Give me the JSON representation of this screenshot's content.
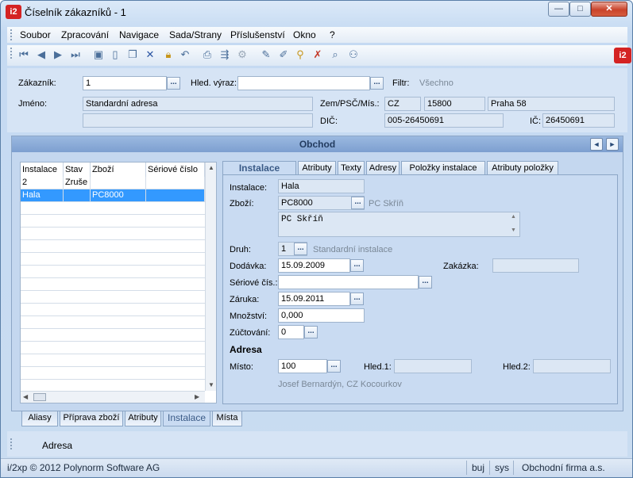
{
  "window": {
    "title": "Číselník zákazníků - 1",
    "app_icon": "i2",
    "controls": {
      "minimize": "—",
      "maximize": "□",
      "close": "✕"
    }
  },
  "menu": [
    "Soubor",
    "Zpracování",
    "Navigace",
    "Sada/Strany",
    "Příslušenství",
    "Okno",
    "?"
  ],
  "toolbar": {
    "icons": [
      "first-icon",
      "prev-icon",
      "next-icon",
      "last-icon",
      "save-icon",
      "new-icon",
      "copy-icon",
      "delete-icon",
      "lock-icon",
      "undo-icon",
      "print-icon",
      "export-icon",
      "settings-icon",
      "pencil-icon",
      "eraser-icon",
      "filter-icon",
      "clear-filter-icon",
      "search-icon",
      "find-user-icon"
    ],
    "logo": "i2"
  },
  "header": {
    "customer_label": "Zákazník:",
    "customer_value": "1",
    "search_label": "Hled. výraz:",
    "search_value": "",
    "filter_label": "Filtr:",
    "filter_value": "Všechno",
    "name_label": "Jméno:",
    "name_value": "Standardní adresa",
    "name2_value": "",
    "country_label": "Zem/PSČ/Mís.:",
    "country_value": "CZ",
    "zip_value": "15800",
    "city_value": "Praha 58",
    "dic_label": "DIČ:",
    "dic_value": "005-26450691",
    "ic_label": "IČ:",
    "ic_value": "26450691"
  },
  "panel": {
    "title": "Obchod",
    "nav_prev": "◄",
    "nav_next": "►"
  },
  "grid": {
    "headers": [
      "Instalace",
      "Stav",
      "Zboží",
      "Sériové číslo"
    ],
    "rows": [
      [
        "2",
        "Zruše",
        "",
        ""
      ],
      [
        "Hala",
        "",
        "PC8000",
        ""
      ]
    ],
    "selected_row": 1
  },
  "tabs": [
    "Instalace",
    "Atributy",
    "Texty",
    "Adresy",
    "Položky instalace",
    "Atributy položky"
  ],
  "detail": {
    "instalace_label": "Instalace:",
    "instalace_value": "Hala",
    "zbozi_label": "Zboží:",
    "zbozi_value": "PC8000",
    "zbozi_name": "PC Skříň",
    "note_value": "PC Skříň",
    "druh_label": "Druh:",
    "druh_value": "1",
    "druh_name": "Standardní instalace",
    "dodavka_label": "Dodávka:",
    "dodavka_value": "15.09.2009",
    "zakazka_label": "Zakázka:",
    "zakazka_value": "",
    "seriove_label": "Sériové čís.:",
    "seriove_value": "",
    "zaruka_label": "Záruka:",
    "zaruka_value": "15.09.2011",
    "mnozstvi_label": "Množství:",
    "mnozstvi_value": "0,000",
    "zuctovani_label": "Zúčtování:",
    "zuctovani_value": "0",
    "adresa_heading": "Adresa",
    "misto_label": "Místo:",
    "misto_value": "100",
    "hled1_label": "Hled.1:",
    "hled1_value": "",
    "hled2_label": "Hled.2:",
    "hled2_value": "",
    "address_text": "Josef Bernardýn, CZ  Kocourkov"
  },
  "bottom_tabs": [
    "Aliasy",
    "Příprava zboží",
    "Atributy",
    "Instalace",
    "Místa"
  ],
  "footer": {
    "tab_label": "Adresa"
  },
  "status": {
    "copyright": "i/2xp © 2012 Polynorm Software AG",
    "user": "buj",
    "system": "sys",
    "company": "Obchodní firma a.s."
  }
}
